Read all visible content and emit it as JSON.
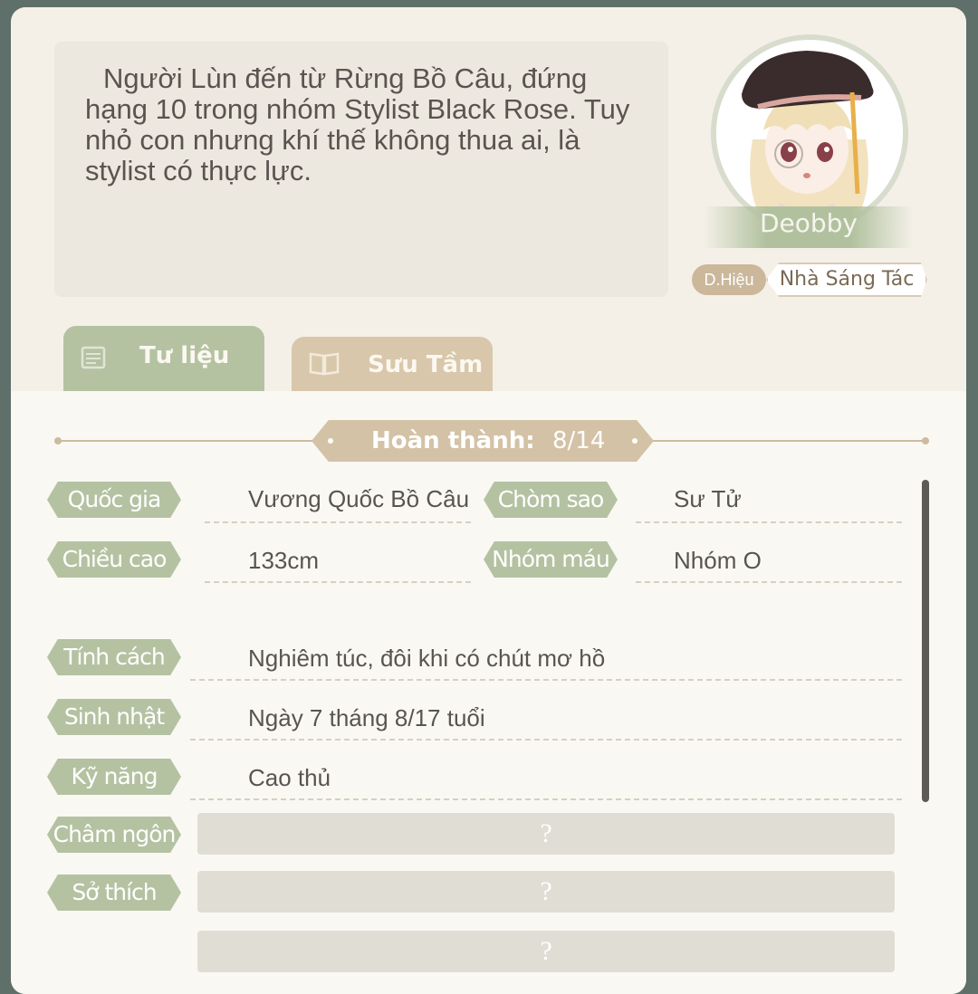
{
  "description": "Người Lùn đến từ Rừng Bồ Câu, đứng hạng 10 trong nhóm Stylist Black Rose. Tuy nhỏ con nhưng khí thế không thua ai, là stylist có thực lực.",
  "character": {
    "name": "Deobby",
    "title_label": "D.Hiệu",
    "title_value": "Nhà Sáng Tác"
  },
  "tabs": [
    {
      "label": "Tư liệu",
      "icon": "document-icon",
      "active": true
    },
    {
      "label": "Sưu Tầm",
      "icon": "book-icon",
      "active": false
    }
  ],
  "progress": {
    "label": "Hoàn thành:",
    "value": "8/14"
  },
  "profile": {
    "country": {
      "label": "Quốc gia",
      "value": "Vương Quốc Bồ Câu"
    },
    "constellation": {
      "label": "Chòm sao",
      "value": "Sư Tử"
    },
    "height": {
      "label": "Chiều cao",
      "value": "133cm"
    },
    "blood_type": {
      "label": "Nhóm máu",
      "value": "Nhóm O"
    },
    "personality": {
      "label": "Tính cách",
      "value": "Nghiêm túc, đôi khi có chút mơ hồ"
    },
    "birthday": {
      "label": "Sinh nhật",
      "value": "Ngày 7 tháng 8/17 tuổi"
    },
    "skill": {
      "label": "Kỹ năng",
      "value": "Cao thủ"
    },
    "motto": {
      "label": "Châm ngôn",
      "value": "?"
    },
    "hobby": {
      "label": "Sở thích",
      "value": "?"
    },
    "extra": {
      "value": "?"
    }
  },
  "colors": {
    "tag_green": "#b4c2a2",
    "tab_tan": "#d8c7aa",
    "badge_tan": "#d3c2a6",
    "text": "#5a5450"
  }
}
